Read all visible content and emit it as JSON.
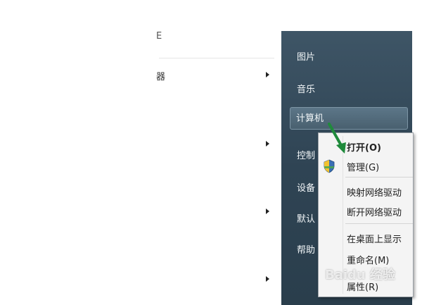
{
  "left_menu": {
    "top_label_fragment": "E",
    "item_label_fragment": "器"
  },
  "right_menu": {
    "items": [
      {
        "label": "图片"
      },
      {
        "label": "音乐"
      },
      {
        "label": "计算机"
      },
      {
        "label": "控制"
      },
      {
        "label": "设备"
      },
      {
        "label": "默认"
      },
      {
        "label": "帮助"
      }
    ]
  },
  "context_menu": {
    "items": [
      {
        "label": "打开(O)"
      },
      {
        "label": "管理(G)"
      },
      {
        "label": "映射网络驱动"
      },
      {
        "label": "断开网络驱动"
      },
      {
        "label": "在桌面上显示"
      },
      {
        "label": "重命名(M)"
      },
      {
        "label": "属性(R)"
      }
    ]
  },
  "watermark": {
    "text": "Baidu 经验"
  },
  "colors": {
    "menu_dark": "#2f4454",
    "highlight": "#5c7688",
    "arrow_green": "#1f8a3b"
  }
}
